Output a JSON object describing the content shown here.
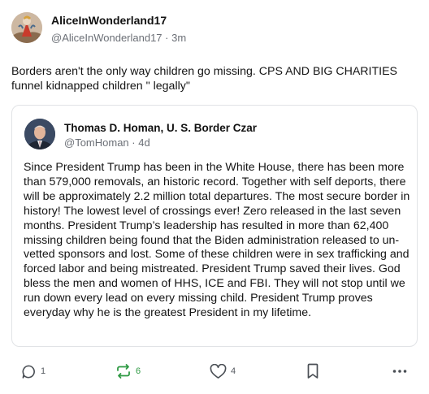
{
  "post": {
    "author": {
      "display_name": "AliceInWonderland17",
      "handle": "@AliceInWonderland17",
      "separator": " · ",
      "time": "3m"
    },
    "text": "Borders aren't the only way children go missing.  CPS AND BIG CHARITIES funnel kidnapped children \" legally\""
  },
  "quote": {
    "author": {
      "display_name": "Thomas D. Homan, U. S. Border Czar",
      "handle": "@TomHoman",
      "separator": " · ",
      "time": "4d"
    },
    "text": "Since President Trump has been in the White House, there has been more than 579,000 removals, an historic record.  Together with self deports, there will be approximately 2.2 million total departures.  The most secure border in history!  The lowest level of crossings ever! Zero released in the last seven months. President Trump’s leadership has resulted in more than  62,400 missing children being found that the Biden administration released to un-vetted sponsors and lost. Some of these children were in sex trafficking and forced labor and being mistreated.  President Trump saved their lives.  God bless the men and women of HHS, ICE and FBI.  They will not stop until we run down every lead on every missing child.  President Trump proves everyday why he is the greatest President in my lifetime."
  },
  "actions": {
    "reply": {
      "icon": "reply-icon",
      "count": "1"
    },
    "repost": {
      "icon": "repost-icon",
      "count": "6",
      "color": "#2f9a44"
    },
    "like": {
      "icon": "heart-icon",
      "count": "4"
    },
    "bookmark": {
      "icon": "bookmark-icon"
    },
    "more": {
      "icon": "more-icon"
    }
  }
}
